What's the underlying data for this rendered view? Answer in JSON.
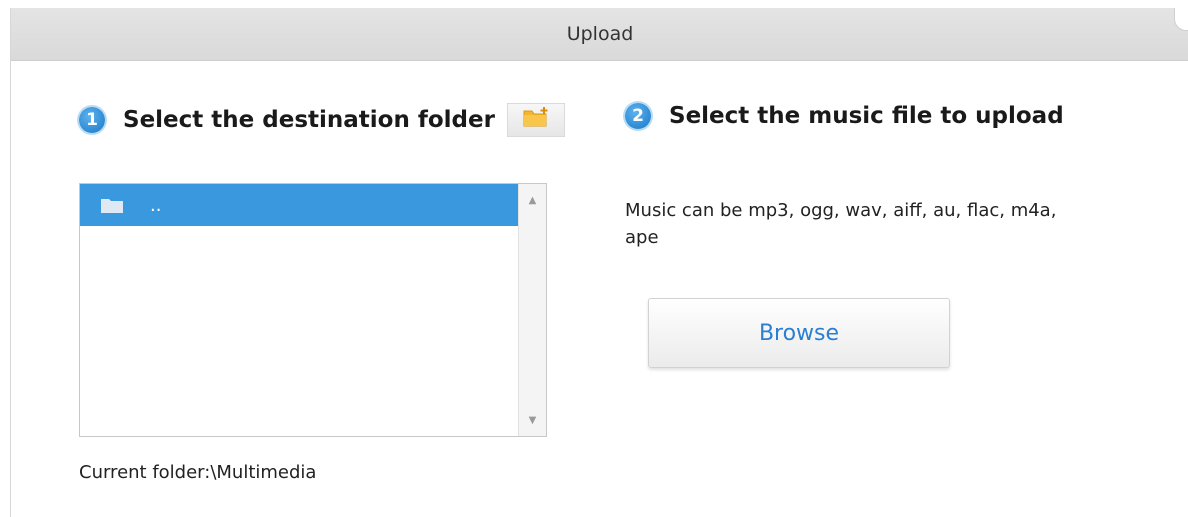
{
  "dialog": {
    "title": "Upload"
  },
  "steps": [
    {
      "number": "1",
      "label": "Select the destination folder"
    },
    {
      "number": "2",
      "label": "Select the music file to upload"
    }
  ],
  "icons": {
    "new_folder": "folder-add-icon",
    "folder": "folder-icon"
  },
  "folder_list": {
    "items": [
      {
        "name": ".."
      }
    ],
    "selected_index": 0
  },
  "current_folder": "Current folder:\\Multimedia",
  "formats_text": "Music can be mp3, ogg, wav, aiff, au, flac, m4a, ape",
  "browse_label": "Browse",
  "colors": {
    "accent": "#3a98df",
    "link": "#2b7fd0"
  }
}
